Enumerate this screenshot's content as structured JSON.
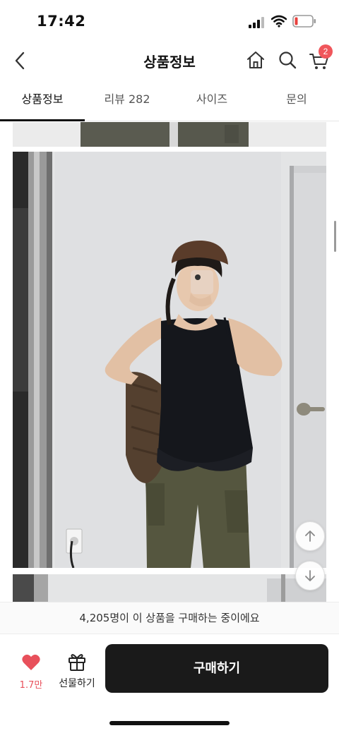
{
  "status_bar": {
    "time": "17:42"
  },
  "header": {
    "title": "상품정보",
    "cart_badge": "2"
  },
  "tabs": [
    {
      "label": "상품정보",
      "active": true
    },
    {
      "label": "리뷰 282",
      "active": false
    },
    {
      "label": "사이즈",
      "active": false
    },
    {
      "label": "문의",
      "active": false
    }
  ],
  "product_images": [
    {
      "description_name": "product-photo-top-crop"
    },
    {
      "description_name": "product-photo-main"
    },
    {
      "description_name": "product-photo-next-crop"
    }
  ],
  "notice": {
    "text": "4,205명이 이 상품을 구매하는 중이에요"
  },
  "bottom_bar": {
    "like_count": "1.7만",
    "gift_label": "선물하기",
    "buy_label": "구매하기"
  },
  "colors": {
    "accent_red": "#e8505b",
    "buy_button": "#1a1a1a",
    "badge": "#f0565b"
  }
}
